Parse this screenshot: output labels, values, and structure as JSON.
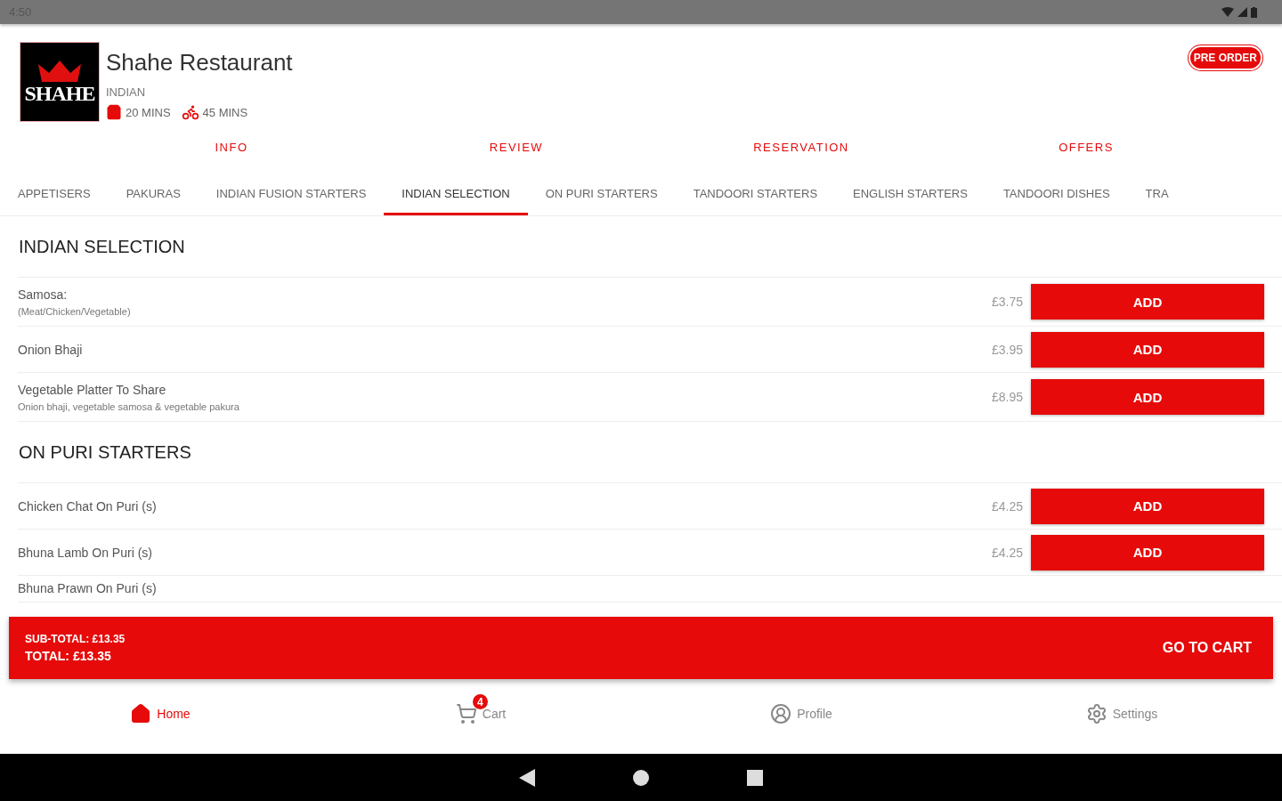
{
  "status_bar": {
    "time": "4:50"
  },
  "restaurant": {
    "logo_text": "SHAHE",
    "name": "Shahe Restaurant",
    "cuisine": "INDIAN",
    "collection_time": "20 MINS",
    "delivery_time": "45 MINS",
    "badge": "PRE ORDER"
  },
  "top_tabs": [
    {
      "label": "INFO"
    },
    {
      "label": "REVIEW"
    },
    {
      "label": "RESERVATION"
    },
    {
      "label": "OFFERS"
    }
  ],
  "categories": [
    {
      "label": "APPETISERS",
      "selected": false
    },
    {
      "label": "PAKURAS",
      "selected": false
    },
    {
      "label": "INDIAN FUSION STARTERS",
      "selected": false
    },
    {
      "label": "INDIAN SELECTION",
      "selected": true
    },
    {
      "label": "ON PURI STARTERS",
      "selected": false
    },
    {
      "label": "TANDOORI STARTERS",
      "selected": false
    },
    {
      "label": "ENGLISH STARTERS",
      "selected": false
    },
    {
      "label": "TANDOORI DISHES",
      "selected": false
    },
    {
      "label": "TRA",
      "selected": false
    }
  ],
  "sections": [
    {
      "title": "INDIAN SELECTION",
      "items": [
        {
          "name": "Samosa:",
          "description": "(Meat/Chicken/Vegetable)",
          "price": "£3.75",
          "button": "ADD"
        },
        {
          "name": "Onion Bhaji",
          "price": "£3.95",
          "button": "ADD"
        },
        {
          "name": "Vegetable Platter To Share",
          "description": "Onion bhaji, vegetable samosa & vegetable pakura",
          "price": "£8.95",
          "button": "ADD"
        }
      ]
    },
    {
      "title": "ON PURI STARTERS",
      "items": [
        {
          "name": "Chicken Chat On Puri (s)",
          "price": "£4.25",
          "button": "ADD"
        },
        {
          "name": "Bhuna Lamb On Puri (s)",
          "price": "£4.25",
          "button": "ADD"
        },
        {
          "name": "Bhuna Prawn On Puri (s)"
        }
      ]
    }
  ],
  "cart_bar": {
    "subtotal": "SUB-TOTAL: £13.35",
    "total": "TOTAL: £13.35",
    "button": "GO TO CART"
  },
  "bottom_nav": [
    {
      "kind": "home",
      "label": "Home",
      "selected": true
    },
    {
      "kind": "cart",
      "label": "Cart",
      "selected": false,
      "badge": "4"
    },
    {
      "kind": "profile",
      "label": "Profile",
      "selected": false
    },
    {
      "kind": "settings",
      "label": "Settings",
      "selected": false
    }
  ]
}
